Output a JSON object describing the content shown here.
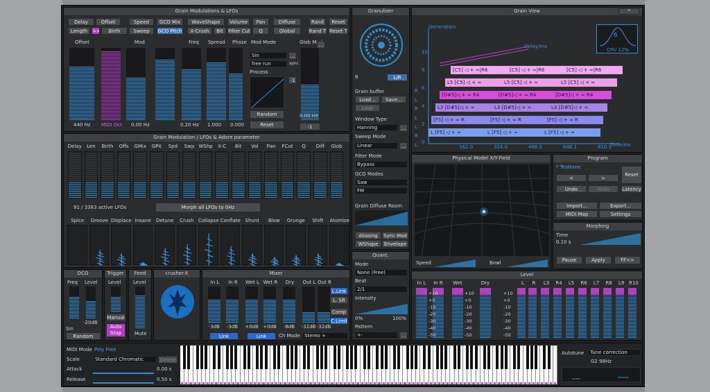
{
  "grain_mod": {
    "title": "Grain Modulations & LFOs",
    "buttons_row1": [
      "Delay",
      "Offset",
      "Speed",
      "GCO Mix",
      "WaveShape",
      "Volume",
      "Pan",
      "Diffuse",
      "Rand",
      "Reset"
    ],
    "buttons_row2": [
      "Length",
      ">>",
      "Birth",
      "Sweep",
      "GCO Pitch",
      "X-Crush",
      "Bit",
      "Filter Cut",
      "Q",
      "Global",
      "Rand T",
      "Reset T"
    ],
    "labels": {
      "offset": "Offset",
      "mod": "Mod",
      "freq": "Freq",
      "spread": "Spread",
      "phase": "Phase",
      "mod_mode": "Mod Mode",
      "glob_mod": "Glob Mod"
    },
    "mod_mode_options": [
      "Sin",
      "free run"
    ],
    "sync": "sync",
    "process": "Process",
    "random": "Random",
    "reset": "Reset",
    "values": {
      "offset": "440 Hz",
      "midi_oct": "MIDI Oct",
      "mod": "0.00 Hz",
      "freq": "0.20 Hz",
      "spread": "1.000",
      "phase": "0.000",
      "glob_mod": "0.00 Hz",
      "glob_neg": "-1",
      "proc_neg": "-1"
    }
  },
  "adore": {
    "title": "Grain Modulation / LFOs & Adore parameter",
    "columns": [
      "Delay",
      "Len",
      "Birth",
      "Offs",
      "GMix",
      "GPit",
      "Spd",
      "Swp",
      "WShp",
      "X-C",
      "Bit",
      "Vol",
      "Pan",
      "FCut",
      "Q",
      "Diff",
      "Glob"
    ],
    "active_lfos": "91 / 3383  active LFOs",
    "morph_button": "Morph all LFOs to 0Hz",
    "effects": [
      "Spice",
      "Groove",
      "Displace",
      "Insane",
      "Detune",
      "Crush",
      "Collapse",
      "Conflate",
      "Shunt",
      "Blow",
      "Grunge",
      "Shift",
      "Atomize"
    ]
  },
  "granulizer": {
    "title": "Granulizer",
    "buffer_value": "8",
    "lr": "L/R",
    "grain_buffer": "Grain buffer",
    "load": "Load...",
    "save": "Save...",
    "loop": "Loop",
    "window_type": "Window Type",
    "window_value": "Hanning",
    "sweep_mode": "Sweep Mode",
    "sweep_value": "Linear",
    "filter_mode": "Filter Mode",
    "filter_value": "Bypass",
    "gco_modes": "GCO Modes",
    "gco_values": [
      "Saw",
      "FM"
    ],
    "diffuse_room": "Grain Diffuse Room",
    "aliasing": "Aliasing",
    "sync_mod": "Sync Mod",
    "wshape": "WShape",
    "envelope": "Envelope",
    "dots": "..."
  },
  "quant": {
    "title": "Quant.",
    "mode": "Mode",
    "mode_value": "None (Free)",
    "beat": "Beat",
    "beat_value": "2/1",
    "intensity": "Intensity",
    "pct_min": "0%",
    "pct_max": "100%",
    "pattern": "Pattern",
    "pattern_value": "+-"
  },
  "grain_view": {
    "title": "Grain View",
    "caret": "^",
    "generators": "Generators",
    "delay_ms": "Delay/ms",
    "time_ms": "Time/ms",
    "cpu_value": "6",
    "cpu_label": "CPU 12%",
    "y_ticks": [
      "10",
      "8",
      "6",
      "4",
      "2",
      "0"
    ],
    "side_letters": [
      "R",
      "L",
      "R",
      "L",
      "L",
      "R",
      "L"
    ],
    "x_ticks": [
      "162.0",
      "324.0",
      "486.0",
      "648.1",
      "810.1"
    ],
    "rows": [
      {
        "label": "[C5] ◁ + ≈|R6",
        "color": "#f2a9f0"
      },
      {
        "label": "L5 [C5] ◁ + ≈",
        "color": "#ec9fe9"
      },
      {
        "label": "[D#5]◁ + ≈ R4",
        "color": "#d94bdc"
      },
      {
        "label": "L3 [D#5]◁ + ≈",
        "color": "#a783e8"
      },
      {
        "label": "[F5] ◁ + ≈ R",
        "color": "#8b88ee"
      },
      {
        "label": "L [F5] ◁ + ≈",
        "color": "#78a0ef"
      }
    ]
  },
  "program": {
    "title": "Program",
    "name": "* Testtone",
    "reset": "Reset",
    "prev": "<",
    "next": ">",
    "undo": "Undo",
    "redo": "Redo",
    "latency": "Latency",
    "import": "Import...",
    "export": "Export...",
    "midi_map": "MIDI Map",
    "settings": "Settings"
  },
  "morphing": {
    "title": "Morphing",
    "time": "Time",
    "time_value": "0.10 s",
    "pause": "Pause",
    "apply": "Apply",
    "ff": "FF>>"
  },
  "physical": {
    "title": "Physical Model X/Y-Field",
    "speed": "Speed",
    "bowl": "Bowl"
  },
  "level": {
    "title": "Level",
    "labels": [
      "In L",
      "In R",
      "Wet",
      "Dry",
      "L",
      "R",
      "L3",
      "R4",
      "L5",
      "R6",
      "L7",
      "R8",
      "L9",
      "R10"
    ],
    "scale": [
      "+10",
      "+0",
      "-10",
      "-20",
      "-30",
      "-40",
      "-50"
    ]
  },
  "dco": {
    "title": "DCO",
    "freq": "Freq",
    "level": "Level",
    "level_value": "-20dB",
    "sin": "Sin",
    "random": "Random"
  },
  "trigger": {
    "title": "Trigger",
    "level": "Level",
    "manual": "Manual",
    "auto_stop": "Auto Stop"
  },
  "feed": {
    "title": "Feed",
    "level": "Level",
    "mute": "Mute"
  },
  "crusher": {
    "title": "crusher-X"
  },
  "mixer": {
    "title": "Mixer",
    "labels": [
      "In L",
      "In R",
      "Wet L",
      "Wet R",
      "Dry",
      "Out L",
      "Out R"
    ],
    "values": [
      "-3dB",
      "-3dB",
      "+0dB",
      "+0dB",
      "-8dB",
      "-32dB",
      "-32dB"
    ],
    "link": "Link",
    "l_link": "L.Link",
    "l_sr": "L. SR",
    "comp": "Comp",
    "c_limit": "C.Limit",
    "ch_mode": "Ch Mode",
    "ch_value": "Stereo +"
  },
  "bottom": {
    "midi_mode": "MIDI Mode",
    "midi_value": "Poly Free",
    "scale": "Scale",
    "scale_value": "Standard Chromatic",
    "delete": "Delete",
    "attack": "Attack",
    "attack_value": "0.00 s",
    "release": "Release",
    "release_value": "0.50 s",
    "autotune": "Autotune",
    "tune_correction": "Tune correction",
    "tune_value": "G2 98Hz"
  },
  "colors": {
    "accent": "#2e8fd3",
    "pink": "#b13fc2",
    "panel": "#2b2c2e"
  }
}
